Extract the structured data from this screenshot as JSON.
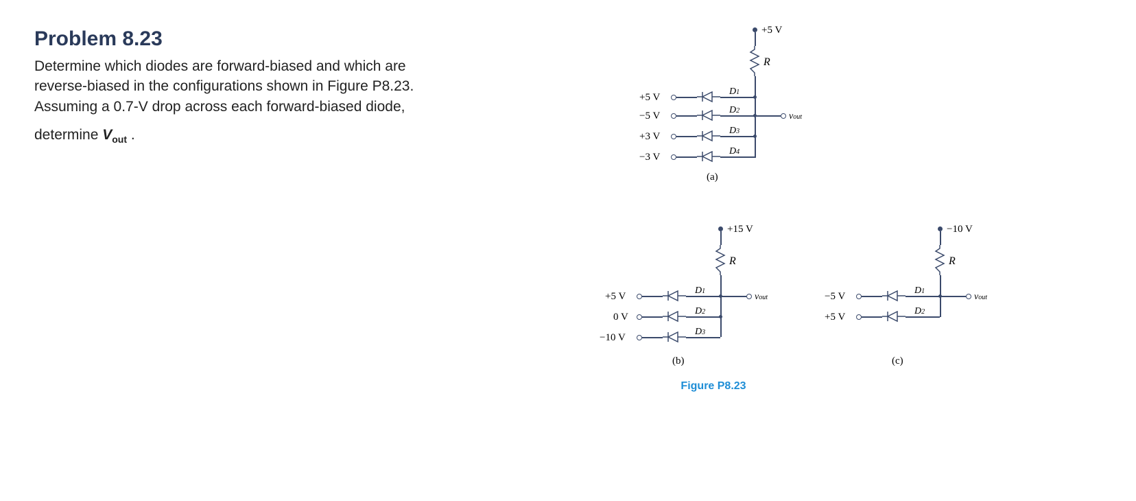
{
  "problem": {
    "title": "Problem 8.23",
    "body_l1": "Determine which diodes are forward-biased and which are",
    "body_l2": "reverse-biased in the configurations shown in Figure P8.23.",
    "body_l3": "Assuming a 0.7-V drop across each forward-biased diode,",
    "body_l4_prefix": "determine ",
    "vout_symbol": "V",
    "vout_sub": "out",
    "body_l4_suffix": " ."
  },
  "figure_caption": "Figure P8.23",
  "circuits": {
    "a": {
      "supply": "+5 V",
      "r_label": "R",
      "inputs": [
        {
          "v": "+5 V",
          "d": "D",
          "dsub": "1"
        },
        {
          "v": "−5 V",
          "d": "D",
          "dsub": "2"
        },
        {
          "v": "+3 V",
          "d": "D",
          "dsub": "3"
        },
        {
          "v": "−3 V",
          "d": "D",
          "dsub": "4"
        }
      ],
      "vout_sym": "v",
      "vout_sub": "out",
      "part": "(a)"
    },
    "b": {
      "supply": "+15 V",
      "r_label": "R",
      "inputs": [
        {
          "v": "+5 V",
          "d": "D",
          "dsub": "1"
        },
        {
          "v": "0 V",
          "d": "D",
          "dsub": "2"
        },
        {
          "v": "−10 V",
          "d": "D",
          "dsub": "3"
        }
      ],
      "vout_sym": "v",
      "vout_sub": "out",
      "part": "(b)"
    },
    "c": {
      "supply": "−10 V",
      "r_label": "R",
      "inputs": [
        {
          "v": "−5 V",
          "d": "D",
          "dsub": "1"
        },
        {
          "v": "+5 V",
          "d": "D",
          "dsub": "2"
        }
      ],
      "vout_sym": "v",
      "vout_sub": "out",
      "part": "(c)"
    }
  }
}
